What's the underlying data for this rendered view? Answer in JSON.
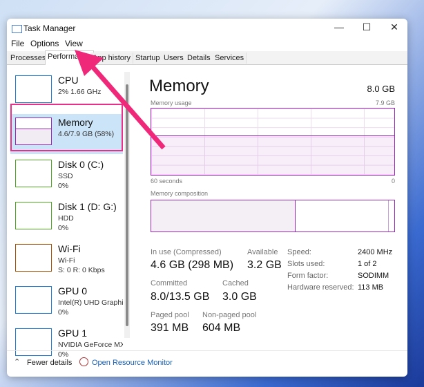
{
  "window": {
    "title": "Task Manager",
    "minimize": "—",
    "maximize": "☐",
    "close": "✕"
  },
  "menu": [
    "File",
    "Options",
    "View"
  ],
  "tabs": [
    "Processes",
    "Performance",
    "App history",
    "Startup",
    "Users",
    "Details",
    "Services"
  ],
  "sidebar": [
    {
      "name": "CPU",
      "line1": "2%  1.66 GHz",
      "line2": "",
      "color": "#1e7bd3"
    },
    {
      "name": "Memory",
      "line1": "4.6/7.9 GB (58%)",
      "line2": "",
      "color": "#9528b4",
      "fill": 0.58
    },
    {
      "name": "Disk 0 (C:)",
      "line1": "SSD",
      "line2": "0%",
      "color": "#4da620"
    },
    {
      "name": "Disk 1 (D: G:)",
      "line1": "HDD",
      "line2": "0%",
      "color": "#4da620"
    },
    {
      "name": "Wi-Fi",
      "line1": "Wi-Fi",
      "line2": "S: 0 R: 0 Kbps",
      "color": "#a74f01"
    },
    {
      "name": "GPU 0",
      "line1": "Intel(R) UHD Graphics",
      "line2": "0%",
      "color": "#1e7bd3"
    },
    {
      "name": "GPU 1",
      "line1": "NVIDIA GeForce MX...",
      "line2": "0%",
      "color": "#1e7bd3"
    }
  ],
  "main": {
    "title": "Memory",
    "total": "8.0 GB",
    "usage_label": "Memory usage",
    "usage_max": "7.9 GB",
    "time_left": "60 seconds",
    "time_right": "0",
    "usage_fraction": 0.58,
    "composition_label": "Memory composition",
    "stats": {
      "in_use_label": "In use (Compressed)",
      "in_use": "4.6 GB (298 MB)",
      "available_label": "Available",
      "available": "3.2 GB",
      "committed_label": "Committed",
      "committed": "8.0/13.5 GB",
      "cached_label": "Cached",
      "cached": "3.0 GB",
      "paged_label": "Paged pool",
      "paged": "391 MB",
      "nonpaged_label": "Non-paged pool",
      "nonpaged": "604 MB"
    },
    "right": [
      {
        "label": "Speed:",
        "value": "2400 MHz"
      },
      {
        "label": "Slots used:",
        "value": "1 of 2"
      },
      {
        "label": "Form factor:",
        "value": "SODIMM"
      },
      {
        "label": "Hardware reserved:",
        "value": "113 MB"
      }
    ]
  },
  "footer": {
    "fewer": "Fewer details",
    "monitor": "Open Resource Monitor"
  },
  "colors": {
    "memory": "#9528b4",
    "annotation": "#f0287a"
  }
}
